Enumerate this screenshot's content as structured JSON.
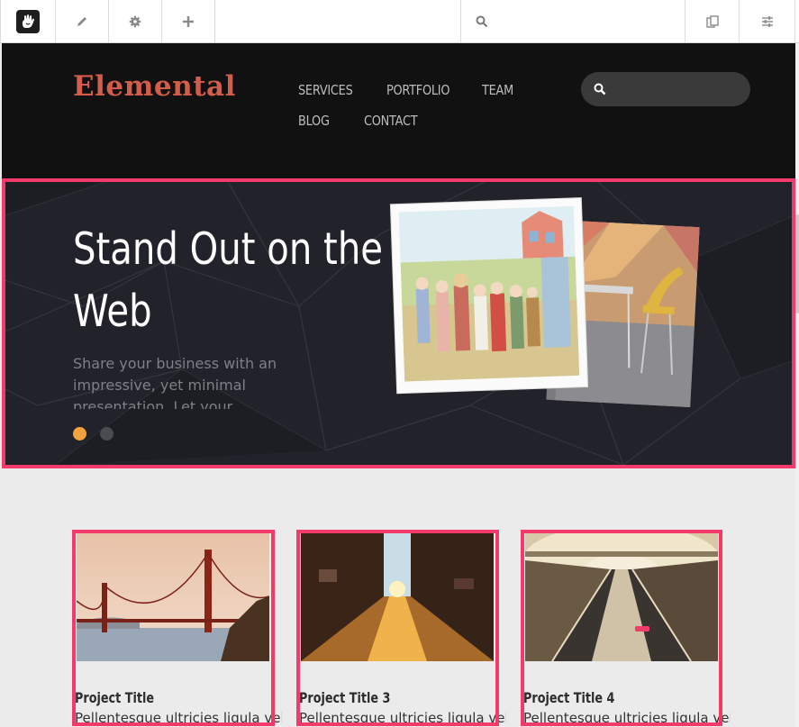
{
  "toolbar": {
    "search_placeholder": "",
    "buttons": [
      "logo",
      "edit",
      "settings",
      "add",
      "search",
      "pages",
      "panel"
    ]
  },
  "site": {
    "brand": "Elemental",
    "nav": [
      "SERVICES",
      "PORTFOLIO",
      "TEAM",
      "BLOG",
      "CONTACT"
    ],
    "search_placeholder": ""
  },
  "hero": {
    "title_line1": "Stand Out on the",
    "title_line2": "Web",
    "text": "Share your business with an impressive, yet minimal presentation. Let your customers",
    "slides": 2,
    "active_slide": 1
  },
  "projects": [
    {
      "title": "Project Title",
      "text": "Pellentesque ultricies ligula vel"
    },
    {
      "title": "Project Title 3",
      "text": "Pellentesque ultricies ligula vel"
    },
    {
      "title": "Project Title 4",
      "text": "Pellentesque ultricies ligula vel"
    }
  ],
  "colors": {
    "brand": "#d45c4a",
    "highlight_outline": "#f23a6b",
    "active_dot": "#f4a23c",
    "header_bg": "#111111",
    "hero_bg": "#22232a"
  }
}
